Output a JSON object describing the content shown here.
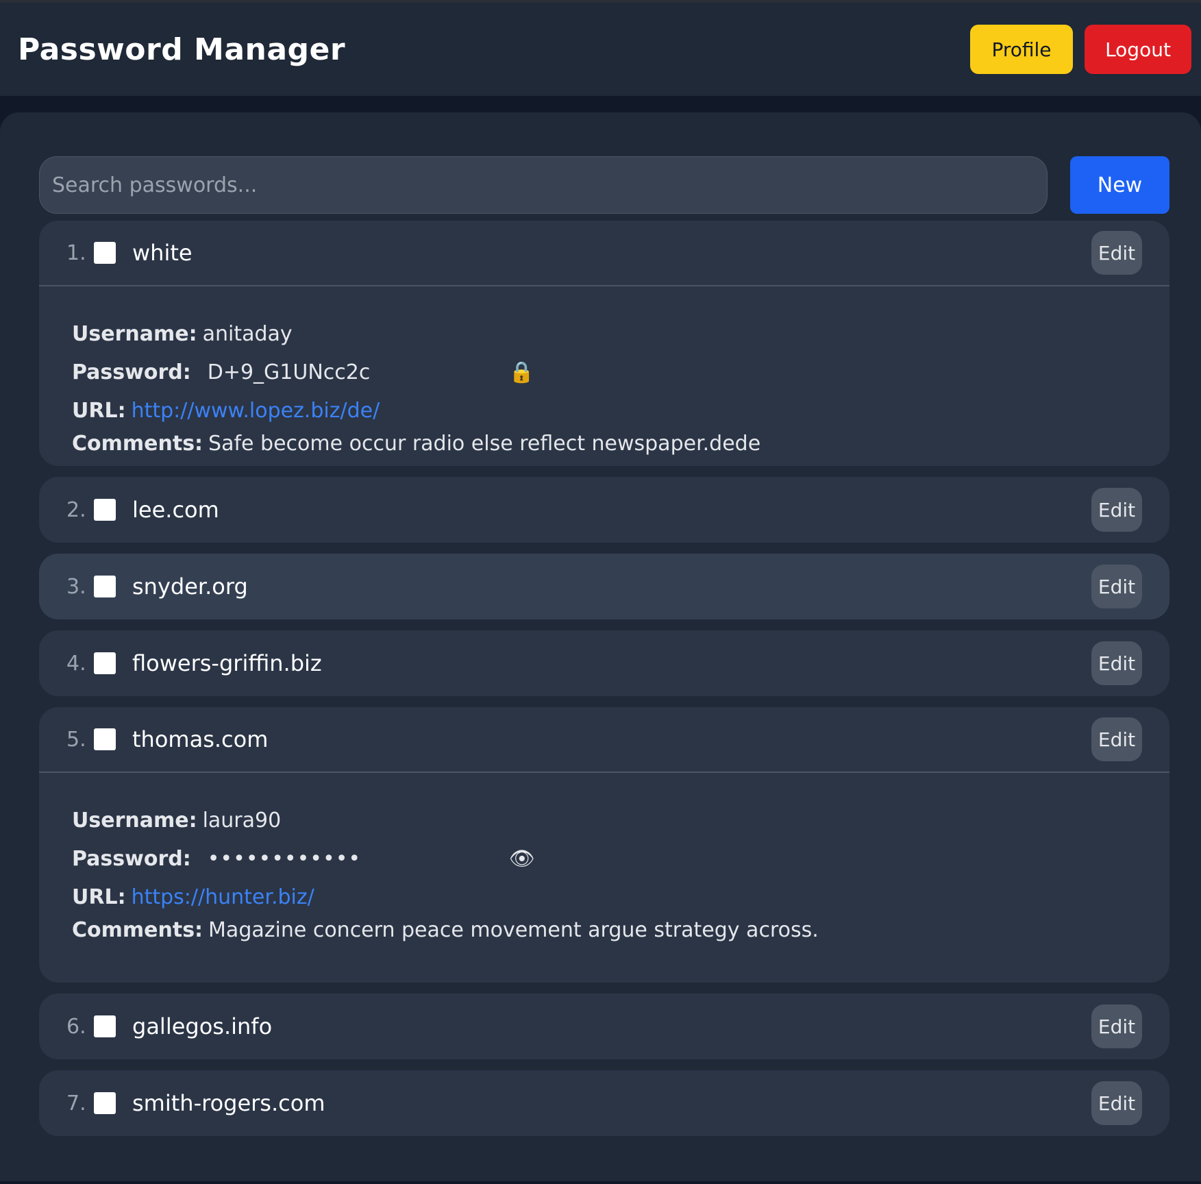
{
  "header": {
    "title": "Password Manager",
    "profile_label": "Profile",
    "logout_label": "Logout"
  },
  "search": {
    "placeholder": "Search passwords...",
    "value": ""
  },
  "new_label": "New",
  "entries": [
    {
      "index": "1.",
      "name": "white",
      "edit_label": "Edit",
      "expanded": true,
      "username_label": "Username:",
      "username": "anitaday",
      "password_label": "Password:",
      "password": "D+9_G1UNcc2c",
      "password_icon": "lock-icon",
      "url_label": "URL:",
      "url": "http://www.lopez.biz/de/",
      "comments_label": "Comments:",
      "comments": "Safe become occur radio else reflect newspaper.dede"
    },
    {
      "index": "2.",
      "name": "lee.com",
      "edit_label": "Edit"
    },
    {
      "index": "3.",
      "name": "snyder.org",
      "edit_label": "Edit"
    },
    {
      "index": "4.",
      "name": "flowers-griffin.biz",
      "edit_label": "Edit"
    },
    {
      "index": "5.",
      "name": "thomas.com",
      "edit_label": "Edit",
      "expanded": true,
      "username_label": "Username:",
      "username": "laura90",
      "password_label": "Password:",
      "password": "••••••••••••",
      "password_icon": "eye-icon",
      "url_label": "URL:",
      "url": "https://hunter.biz/",
      "comments_label": "Comments:",
      "comments": "Magazine concern peace movement argue strategy across."
    },
    {
      "index": "6.",
      "name": "gallegos.info",
      "edit_label": "Edit"
    },
    {
      "index": "7.",
      "name": "smith-rogers.com",
      "edit_label": "Edit"
    }
  ]
}
